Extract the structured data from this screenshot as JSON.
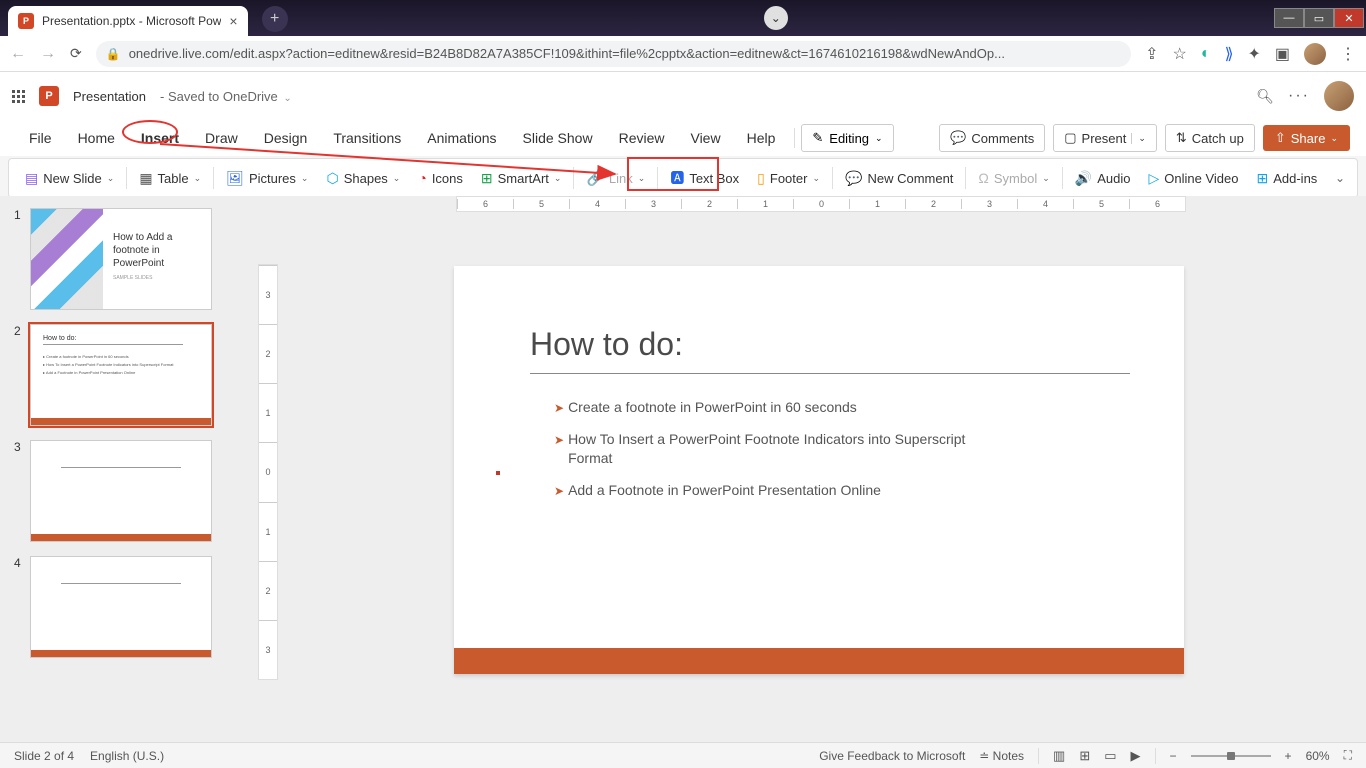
{
  "browser": {
    "tab_title": "Presentation.pptx - Microsoft Pow",
    "url": "onedrive.live.com/edit.aspx?action=editnew&resid=B24B8D82A7A385CF!109&ithint=file%2cpptx&action=editnew&ct=1674610216198&wdNewAndOp..."
  },
  "header": {
    "doc_name": "Presentation",
    "saved_label": "Saved to OneDrive"
  },
  "menu": {
    "file": "File",
    "home": "Home",
    "insert": "Insert",
    "draw": "Draw",
    "design": "Design",
    "transitions": "Transitions",
    "animations": "Animations",
    "slideshow": "Slide Show",
    "review": "Review",
    "view": "View",
    "help": "Help",
    "editing": "Editing",
    "comments": "Comments",
    "present": "Present",
    "catchup": "Catch up",
    "share": "Share"
  },
  "ribbon": {
    "new_slide": "New Slide",
    "table": "Table",
    "pictures": "Pictures",
    "shapes": "Shapes",
    "icons": "Icons",
    "smartart": "SmartArt",
    "link": "Link",
    "textbox": "Text Box",
    "footer": "Footer",
    "new_comment": "New Comment",
    "symbol": "Symbol",
    "audio": "Audio",
    "online_video": "Online Video",
    "addins": "Add-ins"
  },
  "thumbnails": {
    "t1_title": "How to Add a footnote in PowerPoint",
    "t1_sub": "SAMPLE SLIDES",
    "t2_title": "How to do:",
    "t2_b1": "Create a footnote in PowerPoint in 60 seconds",
    "t2_b2": "How To Insert a PowerPoint Footnote Indicators into Superscript Format",
    "t2_b3": "Add a Footnote in PowerPoint Presentation Online",
    "num1": "1",
    "num2": "2",
    "num3": "3",
    "num4": "4"
  },
  "slide": {
    "title": "How to do:",
    "b1": "Create a footnote in PowerPoint in 60 seconds",
    "b2": "How To Insert a PowerPoint Footnote Indicators into Superscript Format",
    "b3": "Add a Footnote in PowerPoint Presentation Online"
  },
  "ruler_h": [
    "6",
    "5",
    "4",
    "3",
    "2",
    "1",
    "0",
    "1",
    "2",
    "3",
    "4",
    "5",
    "6"
  ],
  "ruler_v": [
    "3",
    "2",
    "1",
    "0",
    "1",
    "2",
    "3"
  ],
  "status": {
    "slide_pos": "Slide 2 of 4",
    "lang": "English (U.S.)",
    "feedback": "Give Feedback to Microsoft",
    "notes": "Notes",
    "zoom": "60%"
  }
}
